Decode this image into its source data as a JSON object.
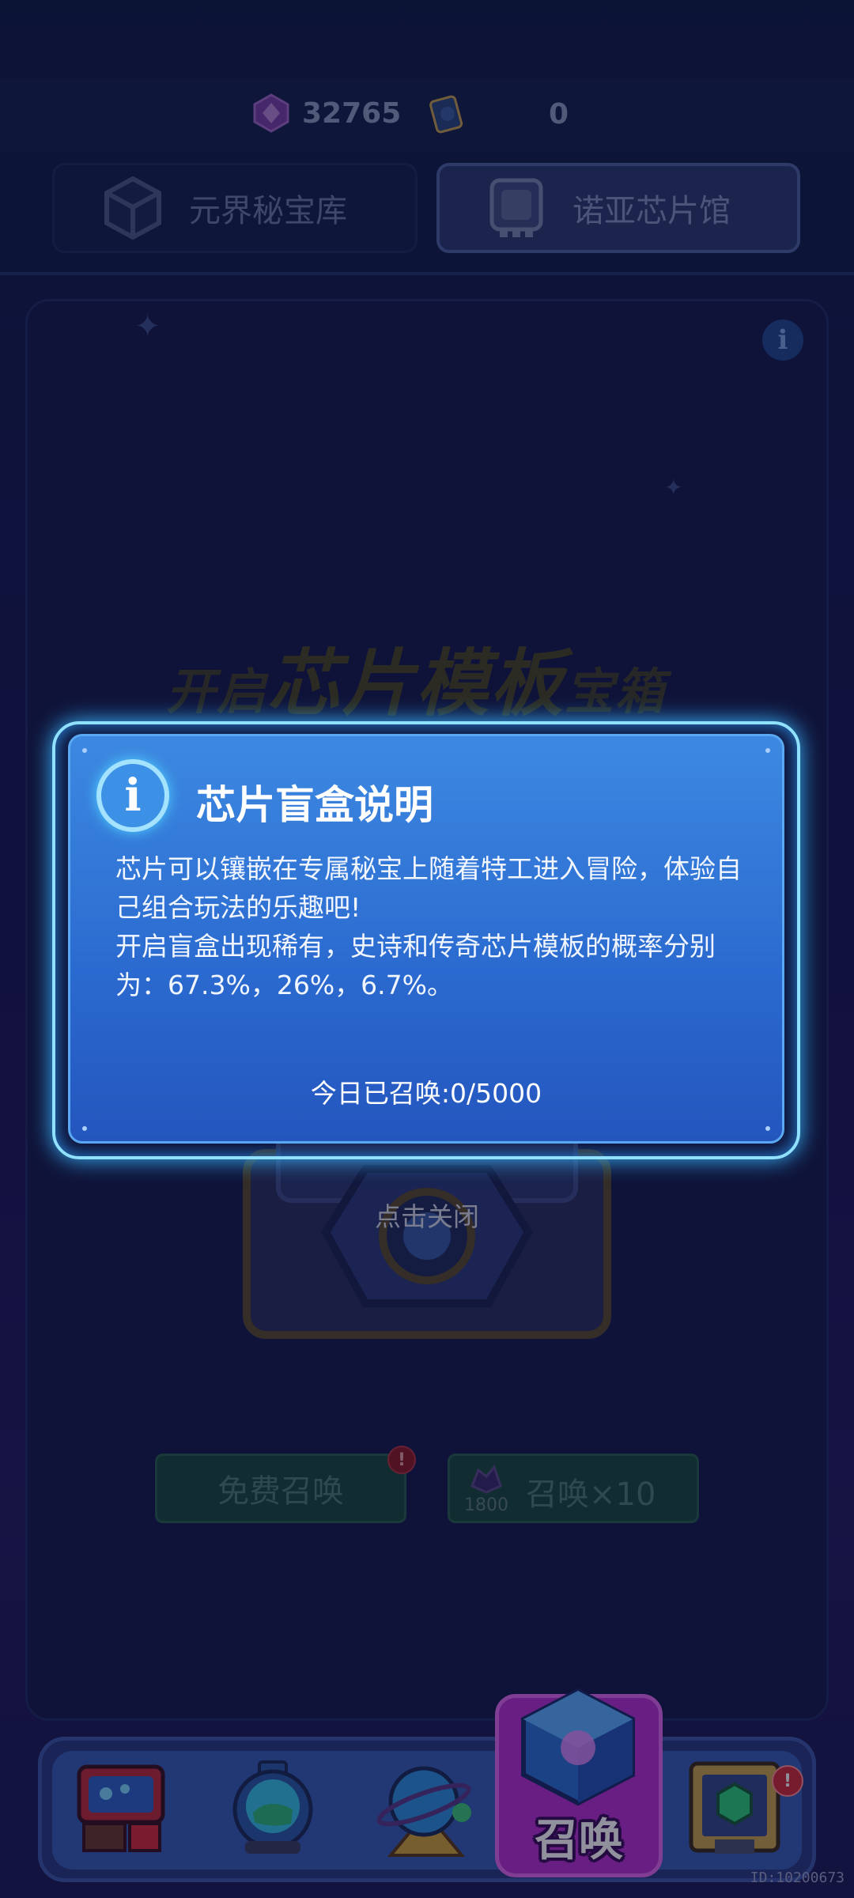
{
  "currency": {
    "gems": "32765",
    "cards": "0"
  },
  "tabs": [
    {
      "label": "元界秘宝库",
      "icon": "cube-icon",
      "active": false
    },
    {
      "label": "诺亚芯片馆",
      "icon": "chip-icon",
      "active": true
    }
  ],
  "background": {
    "title_prefix": "开启",
    "title_main": "芯片模板",
    "title_suffix": "宝箱",
    "close_hint": "点击关闭",
    "free_summon": "免费召唤",
    "summon_ten": "召唤×10",
    "summon_cost": "1800"
  },
  "dialog": {
    "title": "芯片盲盒说明",
    "paragraph1": "芯片可以镶嵌在专属秘宝上随着特工进入冒险，体验自己组合玩法的乐趣吧!",
    "paragraph2": "开启盲盒出现稀有，史诗和传奇芯片模板的概率分别为：67.3%，26%，6.7%。",
    "summon_count": "今日已召唤:0/5000"
  },
  "nav": {
    "items": [
      "robot-icon",
      "helmet-icon",
      "planet-icon",
      "summon-cube-icon",
      "frame-icon"
    ],
    "active_label": "召唤"
  },
  "id_label": "ID:10200673",
  "colors": {
    "dialog_bg": "#2a69cf",
    "glow": "#8fe1ff",
    "nav_active": "#b72fcf"
  }
}
